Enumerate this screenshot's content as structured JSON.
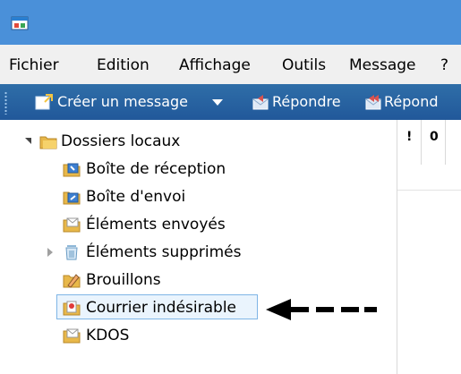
{
  "menubar": {
    "items": [
      "Fichier",
      "Edition",
      "Affichage",
      "Outils",
      "Message",
      "?"
    ]
  },
  "toolbar": {
    "create_message": "Créer un message",
    "reply": "Répondre",
    "reply_all_partial": "Répond"
  },
  "tree": {
    "root": "Dossiers locaux",
    "folders": [
      "Boîte de réception",
      "Boîte d'envoi",
      "Éléments envoyés",
      "Éléments supprimés",
      "Brouillons",
      "Courrier indésirable",
      "KDOS"
    ],
    "selected": "Courrier indésirable"
  },
  "grid": {
    "col1": "!",
    "col2": "0"
  },
  "colors": {
    "titlebar": "#4a90d9",
    "toolbar": "#2563a4",
    "selection_border": "#7fb5e6",
    "selection_fill": "#eaf4fd"
  }
}
